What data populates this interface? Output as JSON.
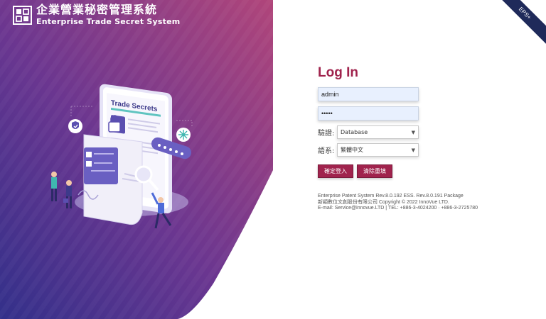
{
  "brand": {
    "title_zh": "企業營業秘密管理系統",
    "title_en": "Enterprise Trade Secret System",
    "logo_icon": "brand-logo-icon"
  },
  "ribbon": {
    "text": "EPS+"
  },
  "illustration": {
    "document_heading": "Trade Secrets",
    "icons": [
      "shield-icon",
      "lock-icon",
      "snowflake-icon",
      "password-dots-icon",
      "magnifier-icon"
    ]
  },
  "login": {
    "title": "Log In",
    "username_value": "admin",
    "password_value": "•••••",
    "verify_label": "驗證:",
    "verify_selected": "Database",
    "language_label": "語系:",
    "language_selected": "繁體中文",
    "confirm_label": "確定登入",
    "clear_label": "清除重填"
  },
  "footer": {
    "line1": "Enterprise Patent System Rev.8.0.192 ESS. Rev.8.0.191 Package",
    "line2": "新穎數位文創股份有限公司 Copyright © 2022 InnoVue LTD.",
    "line3": "E-mail: Service@innovue.LTD | TEL: +886-3-4024200 · +886-3-2725780"
  },
  "colors": {
    "accent": "#a0234d",
    "hero_top": "#8e3b7c",
    "hero_bottom": "#3b2f86",
    "ribbon": "#1f2a5a"
  }
}
